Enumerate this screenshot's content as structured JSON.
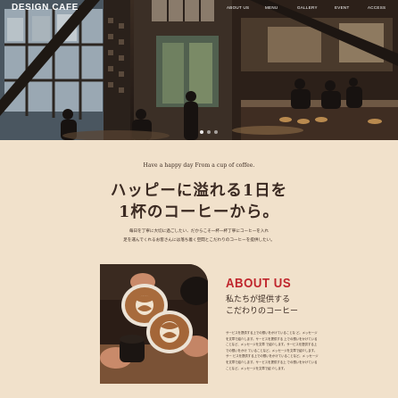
{
  "header": {
    "logo": "DESIGN CAFE",
    "nav": [
      "ABOUT US",
      "MENU",
      "GALLERY",
      "EVENT",
      "ACCESS"
    ]
  },
  "hero": {
    "image": "cafe-interior-photo",
    "slides": 3,
    "active_slide": 1
  },
  "intro": {
    "tagline": "Have a happy day From a cup of coffee.",
    "headline": [
      "ハッピーに溢れる1日を",
      "1杯のコーヒーから。"
    ],
    "description": [
      "毎日を丁寧に大切に過ごしたい、だからこそ一杯一杯丁寧にコーヒーを入れ",
      "足を運んでくれるお客さんには落ち着く空間とこだわりのコーヒーを提供したい。"
    ]
  },
  "about": {
    "image": "latte-art-cups-photo",
    "title": "ABOUT US",
    "subtitle": [
      "私たちが提供する",
      "こだわりのコーヒー"
    ],
    "body": "サービスを提供する上での想いをかけていることな ど。メッセージを文章で紹介します。サービスを提供する 上での想いをかけていることなど、メッセージを文章 で紹介します。サービスを提供する上での想いをかけ ていることなど。メッセージを文章で紹介します。サー ビスを提供する上での想いをかけていることなど。メ ッセージを文章で紹介します。サービスを提供する上 での想いをかけていることなど。メッセージを文章で紹 介します。"
  },
  "colors": {
    "background": "#f1e1cb",
    "accent": "#c0262d",
    "text": "#3b2a22"
  }
}
